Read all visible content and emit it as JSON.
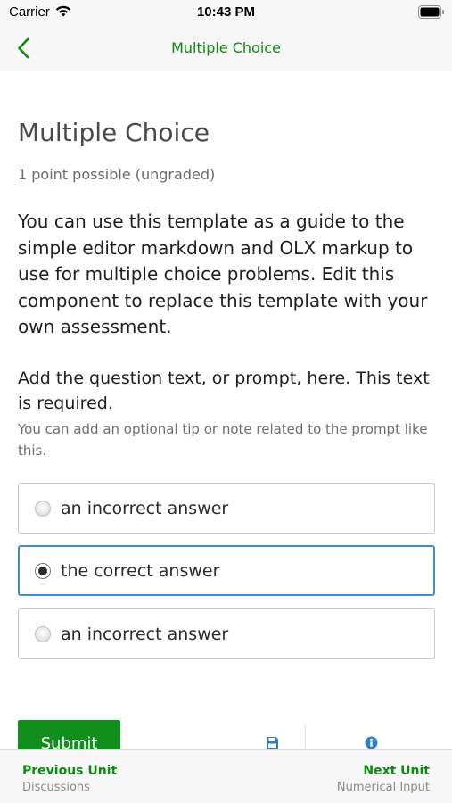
{
  "status_bar": {
    "carrier": "Carrier",
    "time": "10:43 PM"
  },
  "nav": {
    "title": "Multiple Choice",
    "back_icon": "chevron-left-icon",
    "accent_color": "#0c8a12"
  },
  "problem": {
    "title": "Multiple Choice",
    "points": "1 point possible (ungraded)",
    "description": "You can use this template as a guide to the simple editor markdown and OLX markup to use for multiple choice problems. Edit this component to replace this template with your own assessment.",
    "prompt": "Add the question text, or prompt, here. This text is required.",
    "tip": "You can add an optional tip or note related to the prompt like this.",
    "options": [
      {
        "label": "an incorrect answer",
        "selected": false
      },
      {
        "label": "the correct answer",
        "selected": true
      },
      {
        "label": "an incorrect answer",
        "selected": false
      }
    ]
  },
  "actions": {
    "submit_label": "Submit",
    "submit_color": "#108f1c",
    "save_icon": "save-icon",
    "info_icon": "info-icon"
  },
  "bottom_nav": {
    "previous_label": "Previous Unit",
    "previous_sub": "Discussions",
    "next_label": "Next Unit",
    "next_sub": "Numerical Input"
  }
}
